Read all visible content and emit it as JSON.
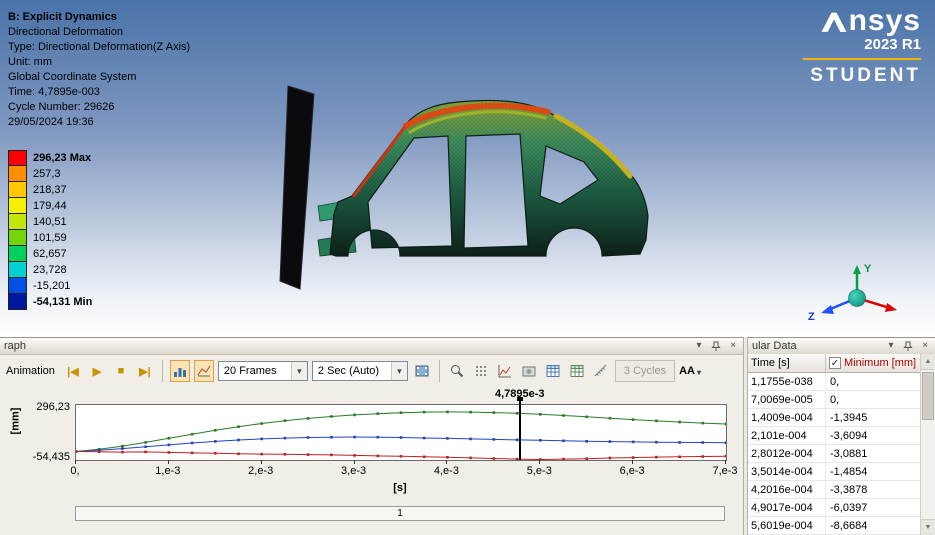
{
  "icons": {
    "menu_arrow": "▾",
    "close": "×",
    "prev": "|◀",
    "play": "▶",
    "stop": "■",
    "next": "▶|",
    "check": "✓",
    "scroll_up": "▲",
    "scroll_down": "▼",
    "dropdown_arrow": "▾"
  },
  "viewport": {
    "info": {
      "title": "B: Explicit Dynamics",
      "lines": [
        "Directional Deformation",
        "Type: Directional Deformation(Z Axis)",
        "Unit: mm",
        "Global Coordinate System",
        "Time: 4,7895e-003",
        "Cycle Number: 29626",
        "29/05/2024 19:36"
      ]
    },
    "legend": {
      "entries": [
        {
          "label": "296,23 Max",
          "color": "#ff0000"
        },
        {
          "label": "257,3",
          "color": "#ff8f00"
        },
        {
          "label": "218,37",
          "color": "#ffc800"
        },
        {
          "label": "179,44",
          "color": "#f6ef00"
        },
        {
          "label": "140,51",
          "color": "#c2e50a"
        },
        {
          "label": "101,59",
          "color": "#71d50a"
        },
        {
          "label": "62,657",
          "color": "#00d05c"
        },
        {
          "label": "23,728",
          "color": "#00d2d2"
        },
        {
          "label": "-15,201",
          "color": "#0050e6"
        },
        {
          "label": "-54,131 Min",
          "color": "#0018a0"
        }
      ]
    },
    "triad": {
      "y": "Y",
      "z": "Z"
    }
  },
  "logo": {
    "brand_text": "nsys",
    "version": "2023 R1",
    "edition": "STUDENT",
    "accent_color": "#f2b400"
  },
  "graph_panel": {
    "title": "raph",
    "toolbar": {
      "animation_label": "Animation",
      "frames_value": "20 Frames",
      "sec_value": "2 Sec (Auto)",
      "cycles_label": "3 Cycles",
      "aa_label": "AA"
    },
    "slider_label": "1"
  },
  "chart_data": {
    "type": "line",
    "xlabel": "[s]",
    "ylabel": "[mm]",
    "xlim": [
      0,
      0.007
    ],
    "ylim": [
      -54.435,
      296.23
    ],
    "y_tick_top": "296,23",
    "y_tick_bottom": "-54,435",
    "x_ticks": [
      "0,",
      "1,e-3",
      "2,e-3",
      "3,e-3",
      "4,e-3",
      "5,e-3",
      "6,e-3",
      "7,e-3"
    ],
    "marker_time": 0.0047895,
    "marker_label": "4,7895e-3",
    "grid": false,
    "legend_position": "none",
    "x": [
      0,
      0.00025,
      0.0005,
      0.00075,
      0.001,
      0.00125,
      0.0015,
      0.00175,
      0.002,
      0.00225,
      0.0025,
      0.00275,
      0.003,
      0.00325,
      0.0035,
      0.00375,
      0.004,
      0.00425,
      0.0045,
      0.00475,
      0.005,
      0.00525,
      0.0055,
      0.00575,
      0.006,
      0.00625,
      0.0065,
      0.00675,
      0.007
    ],
    "series": [
      {
        "name": "green",
        "color": "#2a7a2a",
        "y": [
          0,
          14,
          34,
          58,
          84,
          110,
          135,
          158,
          178,
          196,
          211,
          223,
          233,
          241,
          247,
          251,
          252,
          251,
          248,
          243,
          237,
          229,
          221,
          212,
          203,
          195,
          188,
          181,
          175
        ]
      },
      {
        "name": "blue",
        "color": "#2244bb",
        "y": [
          0,
          8,
          18,
          30,
          42,
          54,
          64,
          73,
          80,
          85,
          89,
          91,
          92,
          91,
          89,
          86,
          83,
          80,
          77,
          74,
          71,
          68,
          65,
          63,
          61,
          59,
          58,
          57,
          56
        ]
      },
      {
        "name": "red",
        "color": "#bb2222",
        "y": [
          0,
          -2,
          -4,
          -3,
          -6,
          -9,
          -12,
          -15,
          -17,
          -18,
          -20,
          -22,
          -25,
          -28,
          -31,
          -34,
          -37,
          -41,
          -45,
          -49,
          -51,
          -49,
          -46,
          -42,
          -39,
          -36,
          -34,
          -32,
          -30
        ]
      }
    ]
  },
  "tabular": {
    "title": "ular Data",
    "col_time": "Time [s]",
    "col_min": "Minimum [mm]",
    "min_color": "#b00000",
    "rows": [
      [
        "1,1755e-038",
        "0,"
      ],
      [
        "7,0069e-005",
        "0,"
      ],
      [
        "1,4009e-004",
        "-1,3945"
      ],
      [
        "2,101e-004",
        "-3,6094"
      ],
      [
        "2,8012e-004",
        "-3,0881"
      ],
      [
        "3,5014e-004",
        "-1,4854"
      ],
      [
        "4,2016e-004",
        "-3,3878"
      ],
      [
        "4,9017e-004",
        "-6,0397"
      ],
      [
        "5,6019e-004",
        "-8,6684"
      ]
    ]
  }
}
